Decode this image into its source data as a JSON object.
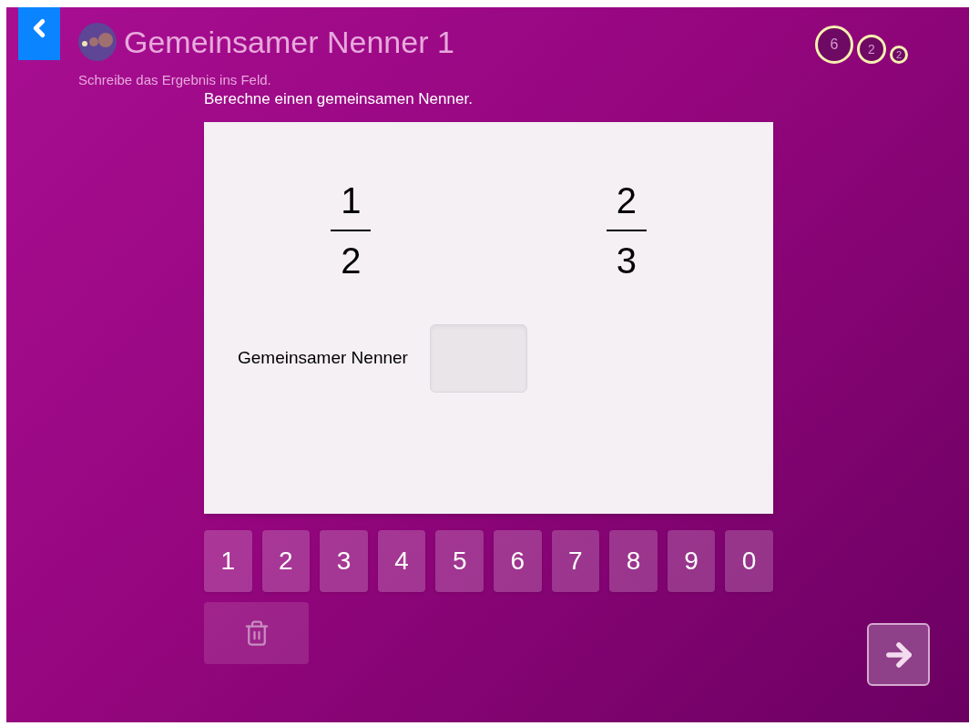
{
  "header": {
    "title": "Gemeinsamer Nenner 1",
    "subtitle": "Schreibe das Ergebnis ins Feld."
  },
  "counters": [
    "6",
    "2",
    "2"
  ],
  "instruction": "Berechne einen gemeinsamen Nenner.",
  "fractions": [
    {
      "numerator": "1",
      "denominator": "2"
    },
    {
      "numerator": "2",
      "denominator": "3"
    }
  ],
  "answer": {
    "label": "Gemeinsamer Nenner"
  },
  "keypad": [
    "1",
    "2",
    "3",
    "4",
    "5",
    "6",
    "7",
    "8",
    "9",
    "0"
  ],
  "delete_button": {
    "disabled": true
  }
}
